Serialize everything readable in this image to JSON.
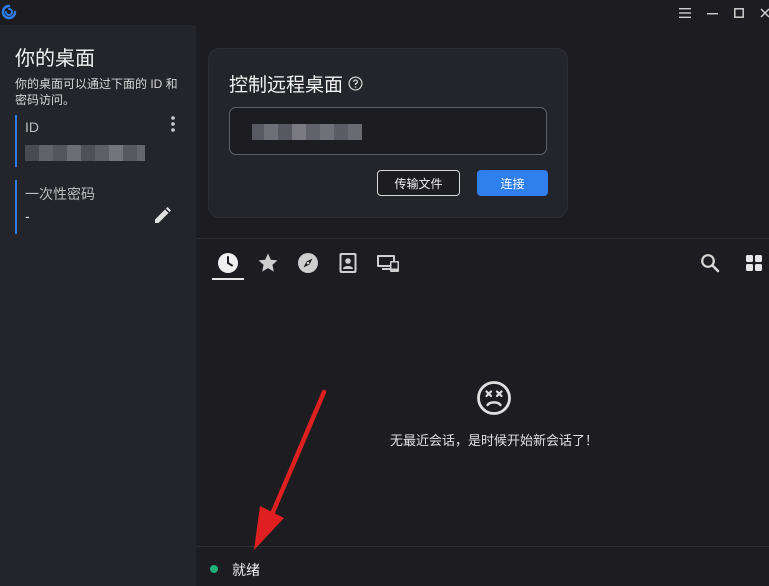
{
  "sidebar": {
    "title": "你的桌面",
    "description": "你的桌面可以通过下面的 ID 和密码访问。",
    "id_label": "ID",
    "password_label": "一次性密码",
    "password_value": "-"
  },
  "control": {
    "title": "控制远程桌面",
    "transfer_label": "传输文件",
    "connect_label": "连接"
  },
  "peers": {
    "tabs": [
      "recent-sessions",
      "favorites",
      "discovered",
      "address-book",
      "accessible-devices"
    ],
    "empty_message": "无最近会话，是时候开始新会话了！"
  },
  "status": {
    "text": "就绪",
    "color": "#1fb07a"
  },
  "theme": {
    "accent": "#2f80ed",
    "annotation": "#e02020"
  }
}
